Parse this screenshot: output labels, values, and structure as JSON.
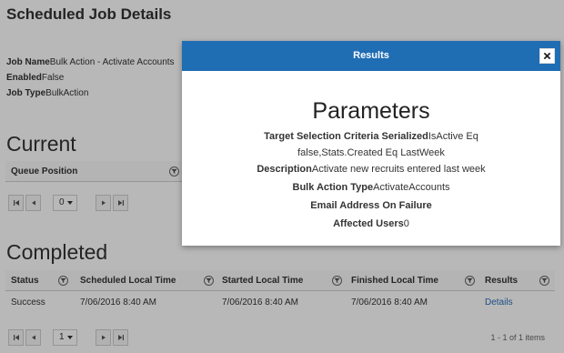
{
  "page": {
    "title": "Scheduled Job Details",
    "details": [
      {
        "label": "Job Name",
        "value": "Bulk Action - Activate Accounts"
      },
      {
        "label": "Enabled",
        "value": "False"
      },
      {
        "label": "Job Type",
        "value": "BulkAction"
      }
    ]
  },
  "current": {
    "title": "Current",
    "columns": [
      "Queue Position"
    ],
    "pager": {
      "page": "0"
    }
  },
  "completed": {
    "title": "Completed",
    "columns": [
      "Status",
      "Scheduled Local Time",
      "Started Local Time",
      "Finished Local Time",
      "Results"
    ],
    "rows": [
      {
        "status": "Success",
        "scheduled": "7/06/2016 8:40 AM",
        "started": "7/06/2016 8:40 AM",
        "finished": "7/06/2016 8:40 AM",
        "results": "Details"
      }
    ],
    "pager": {
      "page": "1",
      "info": "1 - 1 of 1 items"
    }
  },
  "modal": {
    "title": "Results",
    "heading": "Parameters",
    "target_label": "Target Selection Criteria Serialized",
    "target_value_1": "IsActive Eq",
    "target_value_2": "false,Stats.Created Eq LastWeek",
    "description_label": "Description",
    "description_value": "Activate new recruits entered last week",
    "bulk_type_label": "Bulk Action Type",
    "bulk_type_value": "ActivateAccounts",
    "email_label": "Email Address On Failure",
    "email_value": "",
    "affected_label": "Affected Users",
    "affected_value": "0"
  },
  "icons": {
    "filter": "filter-icon",
    "first": "first-page-icon",
    "prev": "prev-page-icon",
    "next": "next-page-icon",
    "last": "last-page-icon",
    "close": "close-icon"
  },
  "colors": {
    "modal_header": "#1f6db3",
    "link": "#2a6ebb"
  }
}
